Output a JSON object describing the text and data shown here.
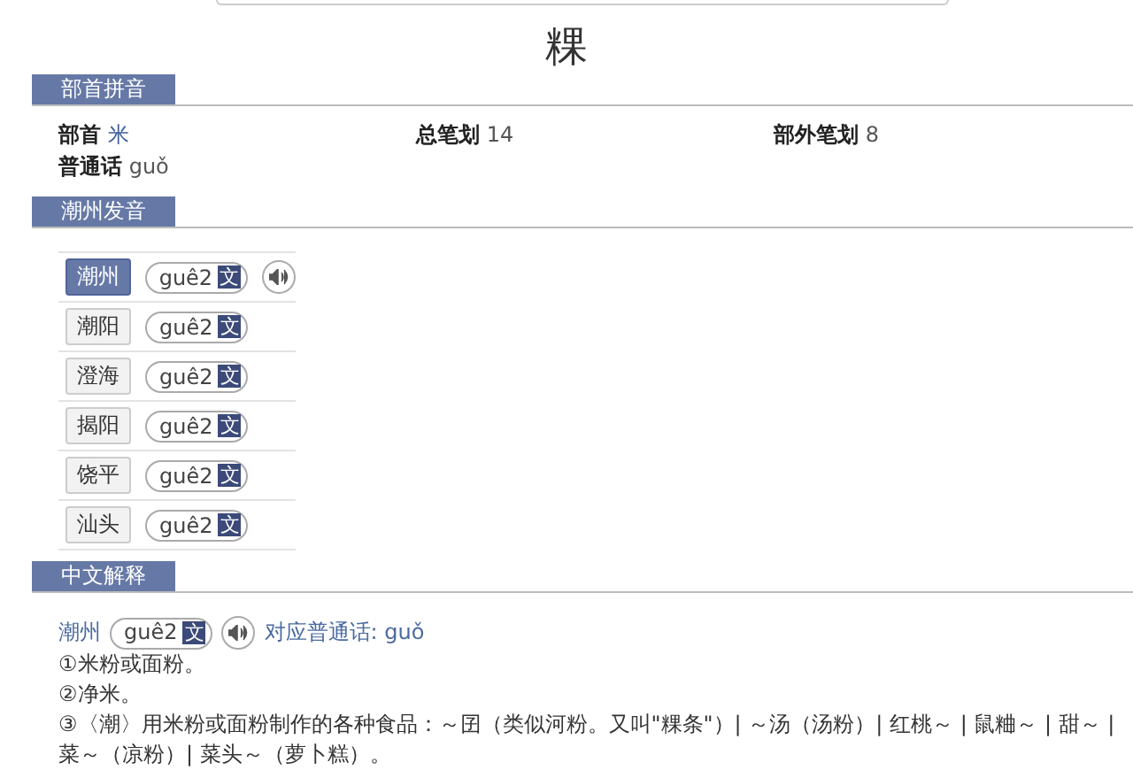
{
  "headword": "粿",
  "radical_section": {
    "title": "部首拼音",
    "fields": [
      {
        "label": "部首",
        "value": "米",
        "link": true
      },
      {
        "label": "总笔划",
        "value": "14",
        "link": false
      },
      {
        "label": "部外笔划",
        "value": "8",
        "link": false
      },
      {
        "label": "普通话",
        "value": "guǒ",
        "link": false
      }
    ]
  },
  "dialect_section": {
    "title": "潮州发音",
    "rows": [
      {
        "place": "潮州",
        "selected": true,
        "reading": "guê2",
        "tag": "文",
        "audio": true
      },
      {
        "place": "潮阳",
        "selected": false,
        "reading": "guê2",
        "tag": "文",
        "audio": false
      },
      {
        "place": "澄海",
        "selected": false,
        "reading": "guê2",
        "tag": "文",
        "audio": false
      },
      {
        "place": "揭阳",
        "selected": false,
        "reading": "guê2",
        "tag": "文",
        "audio": false
      },
      {
        "place": "饶平",
        "selected": false,
        "reading": "guê2",
        "tag": "文",
        "audio": false
      },
      {
        "place": "汕头",
        "selected": false,
        "reading": "guê2",
        "tag": "文",
        "audio": false
      }
    ]
  },
  "definition_section": {
    "title": "中文解释",
    "place": "潮州",
    "reading": "guê2",
    "tag": "文",
    "mandarin": "对应普通话: guǒ",
    "senses": [
      "①米粉或面粉。",
      "②净米。",
      "③〈潮〉用米粉或面粉制作的各种食品：～囝（类似河粉。又叫\"粿条\"）| ～汤（汤粉）| 红桃～ | 鼠粬～ | 甜～ | 菜～（凉粉）| 菜头～（萝卜糕）。"
    ]
  }
}
